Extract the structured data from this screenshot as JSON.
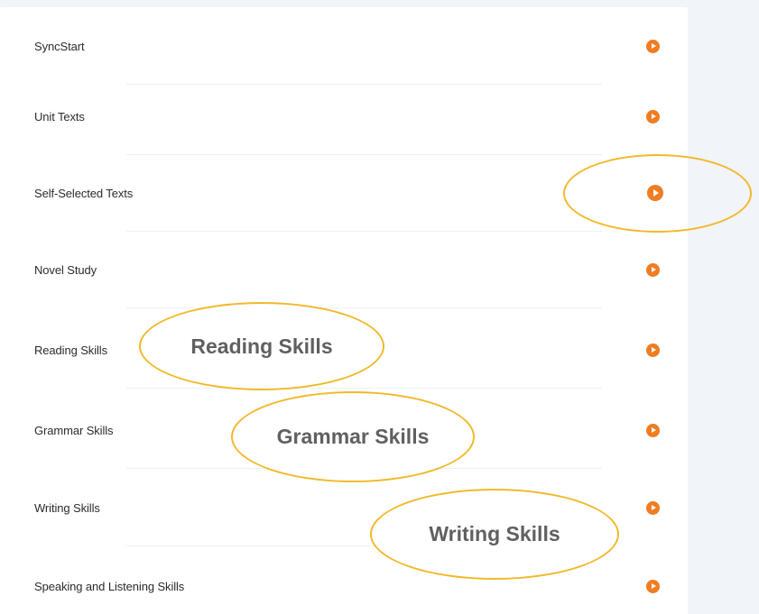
{
  "menu": {
    "items": [
      {
        "label": "SyncStart",
        "icon": "play-circle-icon"
      },
      {
        "label": "Unit Texts",
        "icon": "play-circle-icon"
      },
      {
        "label": "Self-Selected Texts",
        "icon": "play-circle-icon"
      },
      {
        "label": "Novel Study",
        "icon": "play-circle-icon"
      },
      {
        "label": "Reading Skills",
        "icon": "play-circle-icon"
      },
      {
        "label": "Grammar Skills",
        "icon": "play-circle-icon"
      },
      {
        "label": "Writing Skills",
        "icon": "play-circle-icon"
      },
      {
        "label": "Speaking and Listening Skills",
        "icon": "play-circle-icon"
      }
    ]
  },
  "callouts": {
    "reading": "Reading Skills",
    "grammar": "Grammar Skills",
    "writing": "Writing Skills"
  },
  "colors": {
    "accent": "#ef7d22",
    "highlight": "#f2b829",
    "background": "#f1f4f8"
  }
}
